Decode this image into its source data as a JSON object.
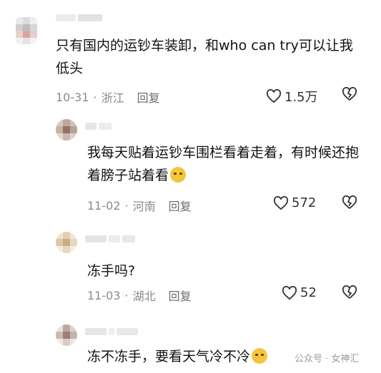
{
  "comments": [
    {
      "text": "只有国内的运钞车装卸，和who can try可以让我低头",
      "date": "10-31",
      "location": "浙江",
      "reply_label": "回复",
      "likes": "1.5万"
    },
    {
      "text": "我每天贴着运钞车围栏看着走着，有时候还抱着膀子站着看",
      "emoji": "laughing-crying-emoji",
      "date": "11-02",
      "location": "河南",
      "reply_label": "回复",
      "likes": "572"
    },
    {
      "text": "冻手吗?",
      "date": "11-03",
      "location": "湖北",
      "reply_label": "回复",
      "likes": "52"
    },
    {
      "text": "冻不冻手，要看天气冷不冷",
      "emoji": "crying-emoji"
    }
  ],
  "watermark": "公众号 · 女神汇",
  "separator": "·",
  "colors": {
    "meta": "#8a8a8a",
    "text": "#111111"
  }
}
